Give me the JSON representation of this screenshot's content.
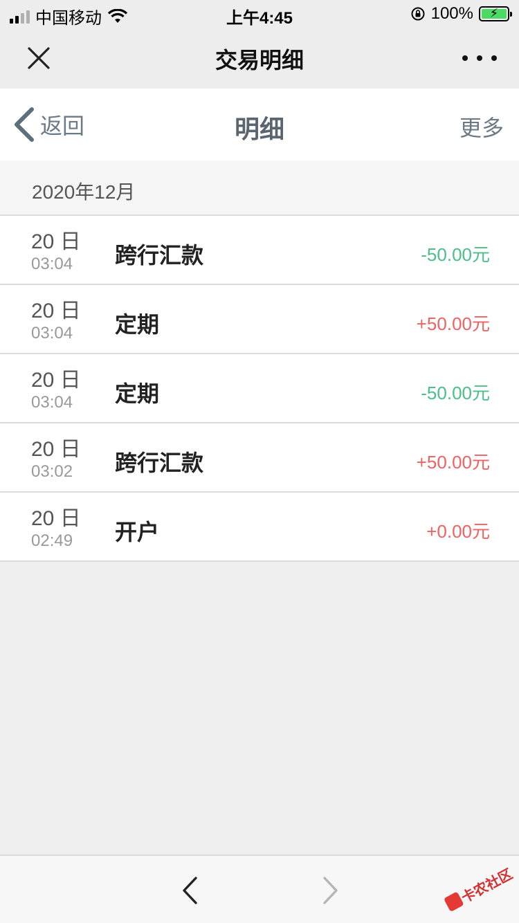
{
  "status_bar": {
    "carrier": "中国移动",
    "time": "上午4:45",
    "battery": "100%"
  },
  "top_nav": {
    "title": "交易明细",
    "close_glyph": "✕"
  },
  "page_header": {
    "back_label": "返回",
    "title": "明细",
    "more_label": "更多"
  },
  "month": {
    "label": "2020年12月"
  },
  "transactions": [
    {
      "day": "20 日",
      "time": "03:04",
      "name": "跨行汇款",
      "amount": "-50.00元",
      "direction": "out"
    },
    {
      "day": "20 日",
      "time": "03:04",
      "name": "定期",
      "amount": "+50.00元",
      "direction": "in"
    },
    {
      "day": "20 日",
      "time": "03:04",
      "name": "定期",
      "amount": "-50.00元",
      "direction": "out"
    },
    {
      "day": "20 日",
      "time": "03:02",
      "name": "跨行汇款",
      "amount": "+50.00元",
      "direction": "in"
    },
    {
      "day": "20 日",
      "time": "02:49",
      "name": "开户",
      "amount": "+0.00元",
      "direction": "in"
    }
  ],
  "watermark": {
    "text": "卡农社区"
  },
  "colors": {
    "negative_amount": "#4bbf87",
    "positive_amount": "#f06262",
    "nav_bg": "#ededed"
  }
}
